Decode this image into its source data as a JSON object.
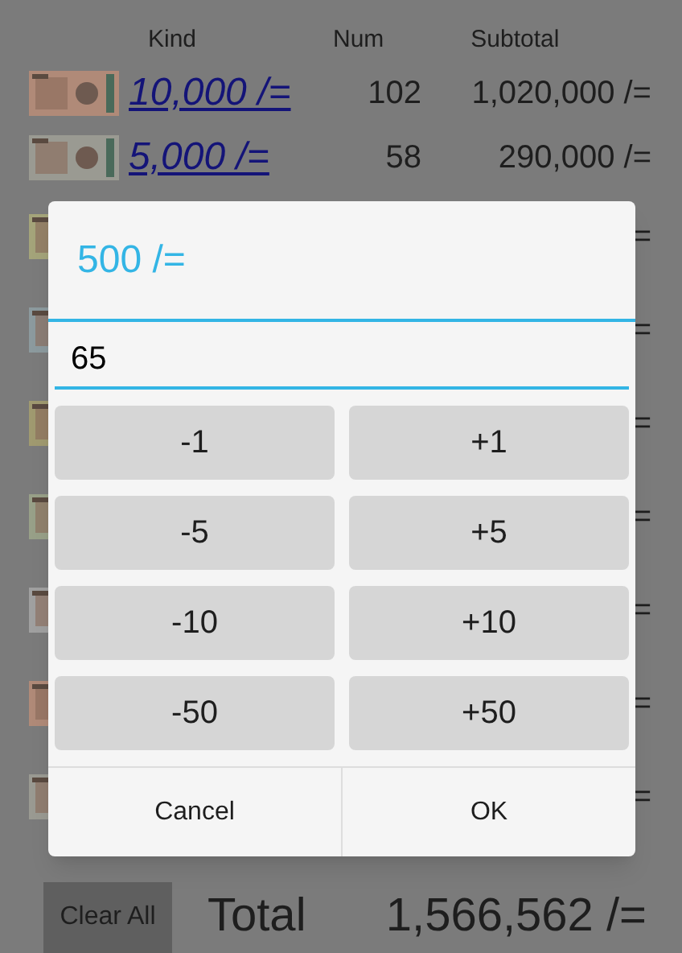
{
  "header": {
    "columns": [
      "Kind",
      "Num",
      "Subtotal"
    ]
  },
  "rows": [
    {
      "kind": "10,000 /=",
      "num": "102",
      "subtotal": "1,020,000 /="
    },
    {
      "kind": "5,000 /=",
      "num": "58",
      "subtotal": "290,000 /="
    }
  ],
  "covered_rows": [
    {
      "subtotal_tail": "="
    },
    {
      "subtotal_tail": "="
    },
    {
      "subtotal_tail": "="
    },
    {
      "subtotal_tail": "="
    },
    {
      "subtotal_tail": "="
    },
    {
      "subtotal_tail": "="
    },
    {
      "subtotal_tail": "="
    }
  ],
  "dialog": {
    "title": "500 /=",
    "value": "65",
    "steps": [
      "-1",
      "+1",
      "-5",
      "+5",
      "-10",
      "+10",
      "-50",
      "+50"
    ],
    "buttons": [
      "Cancel",
      "OK"
    ]
  },
  "footer": {
    "clear_button": "Clear All",
    "total_label": "Total",
    "total_value": "1,566,562 /="
  }
}
